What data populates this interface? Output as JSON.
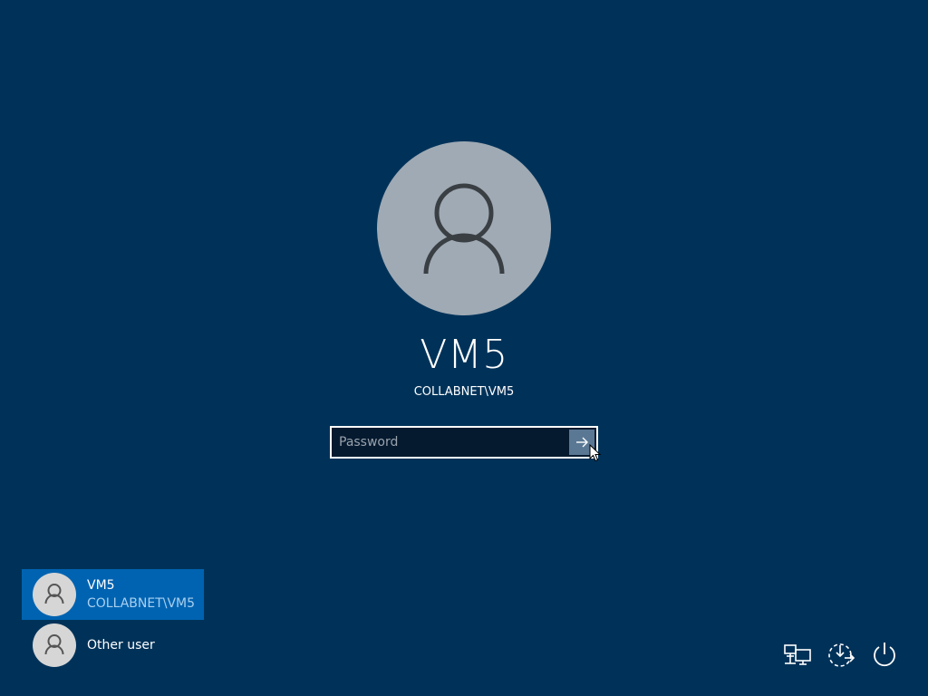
{
  "main_user": {
    "name": "VM5",
    "domain": "COLLABNET\\VM5",
    "avatar_icon": "user-icon"
  },
  "password": {
    "placeholder": "Password",
    "value": "",
    "submit_icon": "arrow-right-icon"
  },
  "user_list": [
    {
      "name": "VM5",
      "domain": "COLLABNET\\VM5",
      "selected": true,
      "icon": "user-icon"
    },
    {
      "name": "Other user",
      "selected": false,
      "icon": "user-icon"
    }
  ],
  "tray": {
    "icons": [
      "network-icon",
      "ease-of-access-icon",
      "power-icon"
    ]
  },
  "colors": {
    "background": "#003259",
    "selected_item": "#0063b1",
    "avatar_large": "#a0aab4",
    "avatar_small": "#d6d6d6"
  }
}
